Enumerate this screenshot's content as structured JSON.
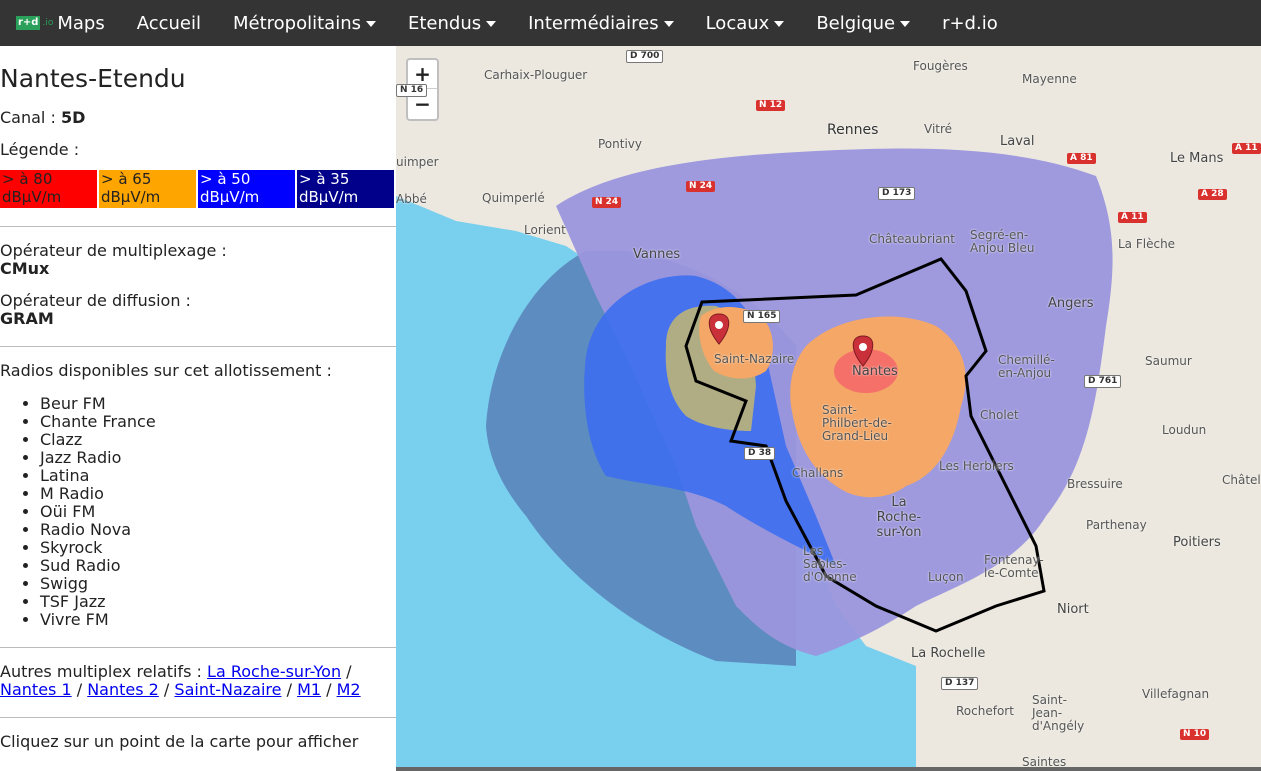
{
  "navbar": {
    "logo_box": "r+d",
    "logo_io": ".io",
    "brand": "Maps",
    "items": [
      {
        "label": "Accueil"
      },
      {
        "label": "Métropolitains"
      },
      {
        "label": "Etendus"
      },
      {
        "label": "Intermédiaires"
      },
      {
        "label": "Locaux"
      },
      {
        "label": "Belgique"
      },
      {
        "label": "r+d.io"
      }
    ]
  },
  "sidebar": {
    "title": "Nantes-Etendu",
    "canal_label": "Canal :",
    "canal_value": "5D",
    "legend_label": "Légende :",
    "legend": [
      {
        "line1": "> à 80",
        "line2": "dBµV/m",
        "color": "#ff0000"
      },
      {
        "line1": "> à 65",
        "line2": "dBµV/m",
        "color": "#ffa500"
      },
      {
        "line1": "> à 50",
        "line2": "dBµV/m",
        "color": "#0000ff"
      },
      {
        "line1": "> à 35",
        "line2": "dBµV/m",
        "color": "#00008b"
      }
    ],
    "mux_label": "Opérateur de multiplexage :",
    "mux_value": "CMux",
    "diff_label": "Opérateur de diffusion :",
    "diff_value": "GRAM",
    "radios_label": "Radios disponibles sur cet allotissement :",
    "radios": [
      "Beur FM",
      "Chante France",
      "Clazz",
      "Jazz Radio",
      "Latina",
      "M Radio",
      "Oüi FM",
      "Radio Nova",
      "Skyrock",
      "Sud Radio",
      "Swigg",
      "TSF Jazz",
      "Vivre FM"
    ],
    "related_label": "Autres multiplex relatifs :",
    "related": [
      "La Roche-sur-Yon",
      "Nantes 1",
      "Nantes 2",
      "Saint-Nazaire",
      "M1",
      "M2"
    ],
    "click_hint": "Cliquez sur un point de la carte pour afficher"
  },
  "map": {
    "zoom_in": "+",
    "zoom_out": "−",
    "places": [
      "Carhaix-Plouguer",
      "Fougères",
      "Mayenne",
      "Rennes",
      "Vitré",
      "Laval",
      "Pontivy",
      "Le Mans",
      "uimper",
      "Quimperlé",
      "Lorient",
      "Vannes",
      "Châteaubriant",
      "Segré-en-Anjou Bleu",
      "La Flèche",
      "Angers",
      "Saint-Nazaire",
      "Nantes",
      "Saumur",
      "Chemillé-en-Anjou",
      "Saint-Philbert-de-Grand-Lieu",
      "Cholet",
      "Loudun",
      "Challans",
      "Les Herbiers",
      "Bressuire",
      "Châtelle",
      "La Roche-sur-Yon",
      "Parthenay",
      "Poitiers",
      "Les Sables-d'Olonne",
      "Fontenay-le-Comte",
      "Luçon",
      "Niort",
      "La Rochelle",
      "Villefagnan",
      "Saint-Jean-d'Angély",
      "Rochefort",
      "Saintes",
      "Abbé"
    ],
    "roads": [
      "D 700",
      "N 12",
      "N 24",
      "N 24",
      "D 173",
      "A 81",
      "A 11",
      "A 28",
      "A 11",
      "N 165",
      "D 761",
      "D 38",
      "D 137",
      "N 10",
      "N 16"
    ]
  }
}
